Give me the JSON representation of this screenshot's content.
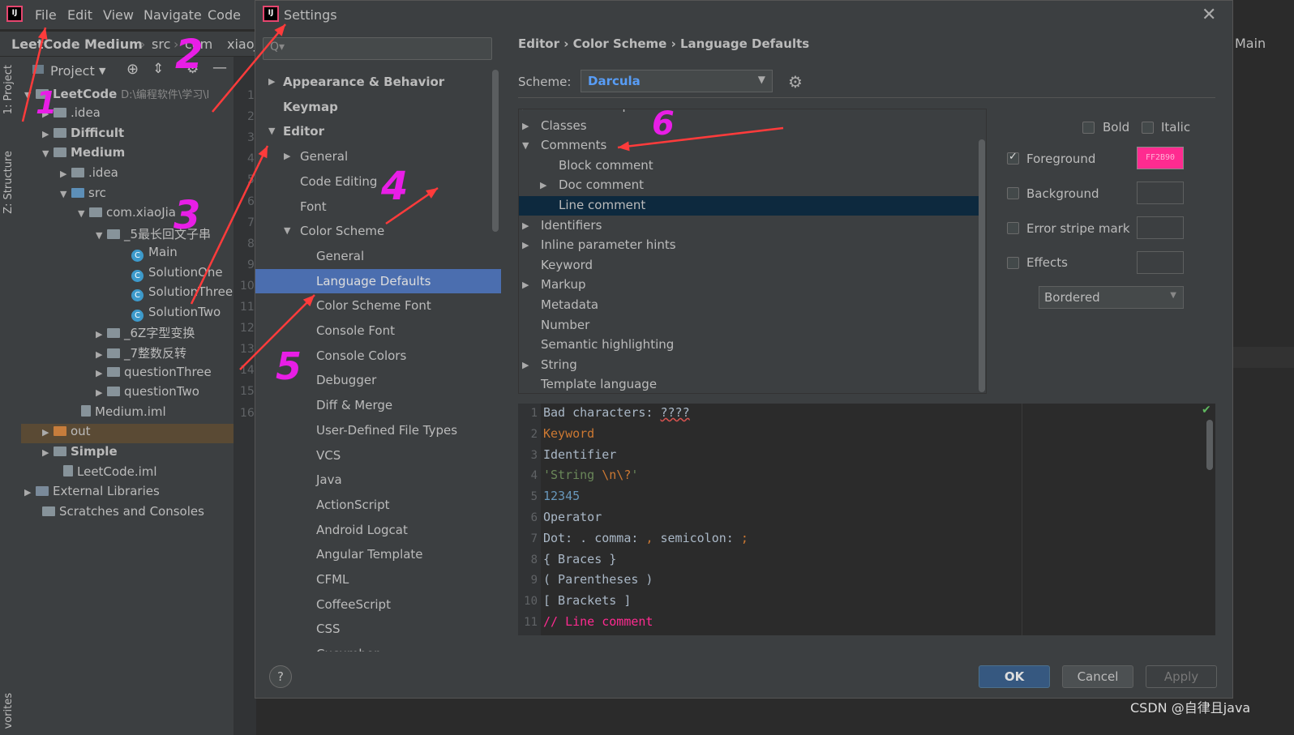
{
  "ide": {
    "menu": [
      "File",
      "Edit",
      "View",
      "Navigate",
      "Code"
    ],
    "breadcrumb": [
      "LeetCode",
      "Medium",
      "src",
      "com",
      "xiaoJ"
    ],
    "right_tab": "Main",
    "left_vertical_tabs": [
      "1: Project",
      "Z: Structure",
      "vorites"
    ],
    "project_toolbar_label": "Project",
    "project_tree": [
      {
        "label": "LeetCode",
        "extra": "D:\\编程软件\\学习\\l",
        "arrow": "▼",
        "bold": true
      },
      {
        "label": ".idea",
        "arrow": "▶"
      },
      {
        "label": "Difficult",
        "arrow": "▶",
        "bold": true
      },
      {
        "label": "Medium",
        "arrow": "▼",
        "bold": true
      },
      {
        "label": ".idea",
        "arrow": "▶"
      },
      {
        "label": "src",
        "arrow": "▼"
      },
      {
        "label": "com.xiaoJia",
        "arrow": "▼"
      },
      {
        "label": "_5最长回文子串",
        "arrow": "▼"
      },
      {
        "label": "Main",
        "arrow": ""
      },
      {
        "label": "SolutionOne",
        "arrow": ""
      },
      {
        "label": "SolutionThree",
        "arrow": ""
      },
      {
        "label": "SolutionTwo",
        "arrow": ""
      },
      {
        "label": "_6Z字型变换",
        "arrow": "▶"
      },
      {
        "label": "_7整数反转",
        "arrow": "▶"
      },
      {
        "label": "questionThree",
        "arrow": "▶"
      },
      {
        "label": "questionTwo",
        "arrow": "▶"
      },
      {
        "label": "Medium.iml",
        "arrow": ""
      },
      {
        "label": "out",
        "arrow": "▶"
      },
      {
        "label": "Simple",
        "arrow": "▶",
        "bold": true
      },
      {
        "label": "LeetCode.iml",
        "arrow": ""
      },
      {
        "label": "External Libraries",
        "arrow": "▶"
      },
      {
        "label": "Scratches and Consoles",
        "arrow": ""
      }
    ],
    "gutter_numbers": [
      "1",
      "2",
      "3",
      "4",
      "5",
      "6",
      "7",
      "8",
      "9",
      "10",
      "11",
      "12",
      "13",
      "14",
      "15",
      "16"
    ]
  },
  "dialog": {
    "title": "Settings",
    "close": "✕",
    "search_placeholder": "Q▾",
    "nav": [
      {
        "label": "Appearance & Behavior",
        "arrow": "▶",
        "bold": true,
        "indent": 0
      },
      {
        "label": "Keymap",
        "arrow": "",
        "bold": true,
        "indent": 0
      },
      {
        "label": "Editor",
        "arrow": "▼",
        "bold": true,
        "indent": 0
      },
      {
        "label": "General",
        "arrow": "▶",
        "indent": 1
      },
      {
        "label": "Code Editing",
        "arrow": "",
        "indent": 1
      },
      {
        "label": "Font",
        "arrow": "",
        "indent": 1
      },
      {
        "label": "Color Scheme",
        "arrow": "▼",
        "indent": 1
      },
      {
        "label": "General",
        "arrow": "",
        "indent": 2
      },
      {
        "label": "Language Defaults",
        "arrow": "",
        "indent": 2,
        "selected": true
      },
      {
        "label": "Color Scheme Font",
        "arrow": "",
        "indent": 2
      },
      {
        "label": "Console Font",
        "arrow": "",
        "indent": 2
      },
      {
        "label": "Console Colors",
        "arrow": "",
        "indent": 2
      },
      {
        "label": "Debugger",
        "arrow": "",
        "indent": 2
      },
      {
        "label": "Diff & Merge",
        "arrow": "",
        "indent": 2
      },
      {
        "label": "User-Defined File Types",
        "arrow": "",
        "indent": 2
      },
      {
        "label": "VCS",
        "arrow": "",
        "indent": 2
      },
      {
        "label": "Java",
        "arrow": "",
        "indent": 2
      },
      {
        "label": "ActionScript",
        "arrow": "",
        "indent": 2
      },
      {
        "label": "Android Logcat",
        "arrow": "",
        "indent": 2
      },
      {
        "label": "Angular Template",
        "arrow": "",
        "indent": 2
      },
      {
        "label": "CFML",
        "arrow": "",
        "indent": 2
      },
      {
        "label": "CoffeeScript",
        "arrow": "",
        "indent": 2
      },
      {
        "label": "CSS",
        "arrow": "",
        "indent": 2
      },
      {
        "label": "Cucumber",
        "arrow": "",
        "indent": 2
      }
    ],
    "crumbs": "Editor  ›  Color Scheme  ›  Language Defaults",
    "scheme_label": "Scheme:",
    "scheme_value": "Darcula",
    "tree": [
      {
        "label": "Braces and Operators",
        "arrow": "▶",
        "indent": 0
      },
      {
        "label": "Classes",
        "arrow": "▶",
        "indent": 0
      },
      {
        "label": "Comments",
        "arrow": "▼",
        "indent": 0
      },
      {
        "label": "Block comment",
        "arrow": "",
        "indent": 1
      },
      {
        "label": "Doc comment",
        "arrow": "▶",
        "indent": 1
      },
      {
        "label": "Line comment",
        "arrow": "",
        "indent": 1,
        "selected": true
      },
      {
        "label": "Identifiers",
        "arrow": "▶",
        "indent": 0
      },
      {
        "label": "Inline parameter hints",
        "arrow": "▶",
        "indent": 0
      },
      {
        "label": "Keyword",
        "arrow": "",
        "indent": 0
      },
      {
        "label": "Markup",
        "arrow": "▶",
        "indent": 0
      },
      {
        "label": "Metadata",
        "arrow": "",
        "indent": 0
      },
      {
        "label": "Number",
        "arrow": "",
        "indent": 0
      },
      {
        "label": "Semantic highlighting",
        "arrow": "",
        "indent": 0
      },
      {
        "label": "String",
        "arrow": "▶",
        "indent": 0
      },
      {
        "label": "Template language",
        "arrow": "",
        "indent": 0
      }
    ],
    "options": {
      "bold": {
        "label": "Bold",
        "checked": false
      },
      "italic": {
        "label": "Italic",
        "checked": false
      },
      "foreground": {
        "label": "Foreground",
        "checked": true,
        "color_text": "FF2B90",
        "color": "#ff2b90"
      },
      "background": {
        "label": "Background",
        "checked": false
      },
      "error_stripe": {
        "label": "Error stripe mark",
        "checked": false
      },
      "effects": {
        "label": "Effects",
        "checked": false
      },
      "effects_type": "Bordered"
    },
    "preview": [
      {
        "n": "1",
        "parts": [
          {
            "t": "Bad characters: ",
            "c": "#a9b7c6"
          },
          {
            "t": "????",
            "c": "#a9b7c6",
            "u": true
          }
        ]
      },
      {
        "n": "2",
        "parts": [
          {
            "t": "Keyword",
            "c": "#cc7832"
          }
        ]
      },
      {
        "n": "3",
        "parts": [
          {
            "t": "Identifier",
            "c": "#a9b7c6"
          }
        ]
      },
      {
        "n": "4",
        "parts": [
          {
            "t": "'String ",
            "c": "#6a8759"
          },
          {
            "t": "\\n\\?",
            "c": "#cc7832"
          },
          {
            "t": "'",
            "c": "#6a8759"
          }
        ]
      },
      {
        "n": "5",
        "parts": [
          {
            "t": "12345",
            "c": "#6897bb"
          }
        ]
      },
      {
        "n": "6",
        "parts": [
          {
            "t": "Operator",
            "c": "#a9b7c6"
          }
        ]
      },
      {
        "n": "7",
        "parts": [
          {
            "t": "Dot: . comma: ",
            "c": "#a9b7c6"
          },
          {
            "t": ",",
            "c": "#cc7832"
          },
          {
            "t": " semicolon: ",
            "c": "#a9b7c6"
          },
          {
            "t": ";",
            "c": "#cc7832"
          }
        ]
      },
      {
        "n": "8",
        "parts": [
          {
            "t": "{ Braces }",
            "c": "#a9b7c6"
          }
        ]
      },
      {
        "n": "9",
        "parts": [
          {
            "t": "( Parentheses )",
            "c": "#a9b7c6"
          }
        ]
      },
      {
        "n": "10",
        "parts": [
          {
            "t": "[ Brackets ]",
            "c": "#a9b7c6"
          }
        ]
      },
      {
        "n": "11",
        "parts": [
          {
            "t": "// Line comment",
            "c": "#ff2b90"
          }
        ]
      }
    ],
    "buttons": {
      "help": "?",
      "ok": "OK",
      "cancel": "Cancel",
      "apply": "Apply"
    }
  },
  "annotations": {
    "numbers": [
      "1",
      "2",
      "3",
      "4",
      "5",
      "6"
    ],
    "arrow_color": "#ff3b3b",
    "number_color": "#e81ee6"
  },
  "watermark": "CSDN @自律且java"
}
